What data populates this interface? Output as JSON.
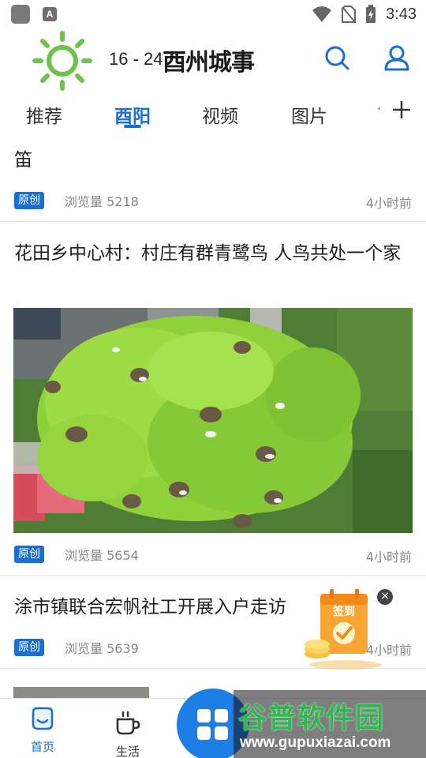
{
  "status_bar": {
    "time": "3:43",
    "notify_letter": "A"
  },
  "header": {
    "weather": "16 - 24",
    "brand": "酉州城事",
    "search_icon": "search-icon",
    "user_icon": "user-icon"
  },
  "tabs": {
    "items": [
      {
        "label": "推荐"
      },
      {
        "label": "酉阳"
      },
      {
        "label": "视频"
      },
      {
        "label": "图片"
      }
    ],
    "active_index": 1,
    "more_label": "·"
  },
  "articles": [
    {
      "title": "笛",
      "badge": "原创",
      "views": "浏览量 5218",
      "time": "4小时前"
    },
    {
      "title": "花田乡中心村：村庄有群青鹭鸟 人鸟共处一个家",
      "badge": "原创",
      "views": "浏览量  5654",
      "time": "4小时前"
    },
    {
      "title": "涂市镇联合宏帆社工开展入户走访",
      "badge": "原创",
      "views": "浏览量  5639",
      "time": "4小时前"
    }
  ],
  "float_promo": {
    "label": "签到",
    "close": "×"
  },
  "bottom_nav": {
    "items": [
      {
        "label": "首页",
        "icon": "home-icon"
      },
      {
        "label": "生活",
        "icon": "coffee-cup-icon"
      }
    ]
  },
  "watermark": {
    "title": "谷普软件园",
    "url": "www.gupuxiazai.com"
  },
  "colors": {
    "accent": "#1a6fcf",
    "sun": "#6cc24a",
    "watermark_green": "#2db84f"
  }
}
